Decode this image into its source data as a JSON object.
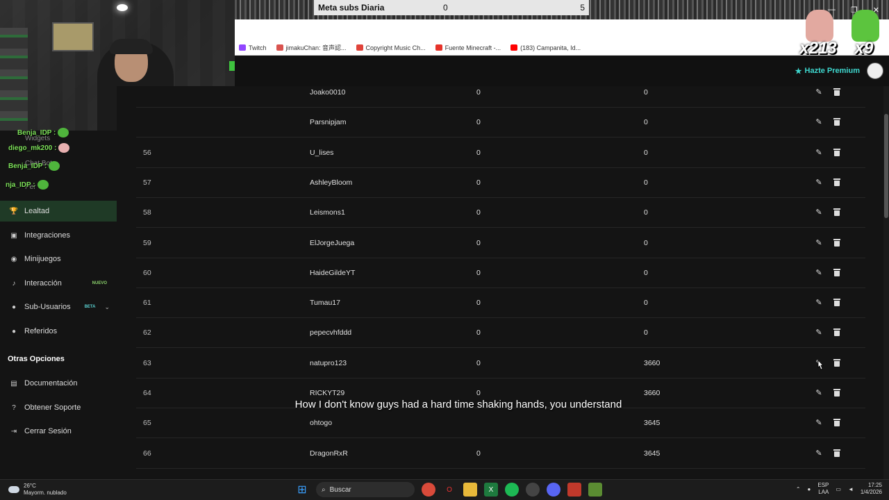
{
  "overlay": {
    "meta_label": "Meta subs Diaria",
    "meta_current": "0",
    "meta_goal": "5",
    "badge1": "x213",
    "badge2": "x9"
  },
  "bookmarks": [
    {
      "label": "Twitch",
      "color": "#9146ff"
    },
    {
      "label": "jimakuChan: 音声認...",
      "color": "#d9534f"
    },
    {
      "label": "Copyright Music Ch...",
      "color": "#e0433a"
    },
    {
      "label": "Fuente Minecraft -...",
      "color": "#e6332a"
    },
    {
      "label": "(183) Campanita, Id...",
      "color": "#ff0000"
    }
  ],
  "header": {
    "premium_label": "Hazte Premium"
  },
  "chat": {
    "lines": [
      {
        "name": "Benja_IDP :"
      },
      {
        "name": "diego_mk200 :"
      },
      {
        "name": "Benja_IDP :"
      },
      {
        "name": "nja_IDP :"
      }
    ],
    "ghost_items": [
      "Widgets",
      "Chat Bot",
      "Per"
    ]
  },
  "sidebar": {
    "items": [
      {
        "label": "Lealtad",
        "icon": "trophy-icon",
        "active": true
      },
      {
        "label": "Integraciones",
        "icon": "puzzle-icon"
      },
      {
        "label": "Minijuegos",
        "icon": "gamepad-icon"
      },
      {
        "label": "Interacción",
        "icon": "music-icon",
        "tag": "NUEVO"
      },
      {
        "label": "Sub-Usuarios",
        "icon": "users-icon",
        "tag": "BETA"
      },
      {
        "label": "Referidos",
        "icon": "user-plus-icon"
      }
    ],
    "section_title": "Otras Opciones",
    "other": [
      {
        "label": "Documentación",
        "icon": "doc-icon"
      },
      {
        "label": "Obtener Soporte",
        "icon": "help-icon"
      },
      {
        "label": "Cerrar Sesión",
        "icon": "logout-icon"
      }
    ]
  },
  "table": {
    "rows": [
      {
        "id": "",
        "user": "Joako0010",
        "a": "0",
        "b": "0"
      },
      {
        "id": "",
        "user": "Parsnipjam",
        "a": "0",
        "b": "0"
      },
      {
        "id": "56",
        "user": "U_lises",
        "a": "0",
        "b": "0"
      },
      {
        "id": "57",
        "user": "AshleyBloom",
        "a": "0",
        "b": "0"
      },
      {
        "id": "58",
        "user": "Leismons1",
        "a": "0",
        "b": "0"
      },
      {
        "id": "59",
        "user": "ElJorgeJuega",
        "a": "0",
        "b": "0"
      },
      {
        "id": "60",
        "user": "HaideGildeYT",
        "a": "0",
        "b": "0"
      },
      {
        "id": "61",
        "user": "Tumau17",
        "a": "0",
        "b": "0"
      },
      {
        "id": "62",
        "user": "pepecvhfddd",
        "a": "0",
        "b": "0"
      },
      {
        "id": "63",
        "user": "natupro123",
        "a": "0",
        "b": "3660"
      },
      {
        "id": "64",
        "user": "RICKYT29",
        "a": "0",
        "b": "3660"
      },
      {
        "id": "65",
        "user": "ohtogo",
        "a": "",
        "b": "3645"
      },
      {
        "id": "66",
        "user": "DragonRxR",
        "a": "0",
        "b": "3645"
      }
    ]
  },
  "subtitle": "How I don't know guys had a hard time shaking hands, you understand",
  "taskbar": {
    "temp": "26°C",
    "weather": "Mayorm. nublado",
    "search_placeholder": "Buscar",
    "lang1": "ESP",
    "lang2": "LAA",
    "time": "17:25",
    "date": "1/4/2026"
  }
}
